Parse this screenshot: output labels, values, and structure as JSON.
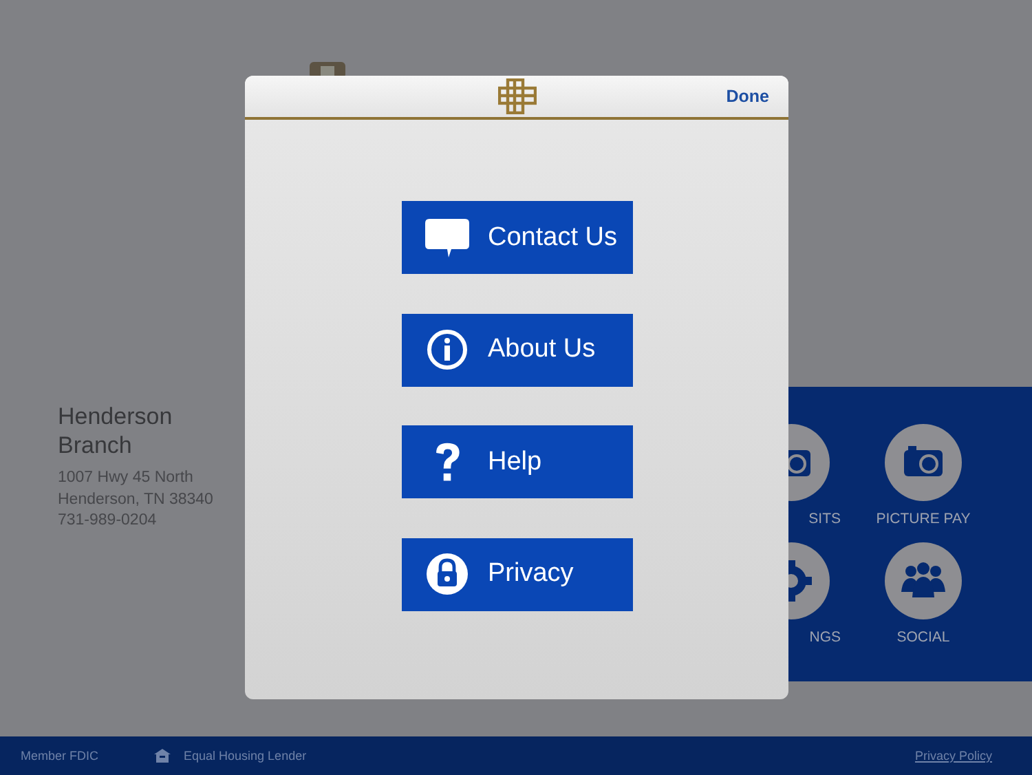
{
  "branch": {
    "name": "Henderson Branch",
    "address_lines": [
      "1007 Hwy 45 North",
      "Henderson, TN 38340",
      "731-989-0204"
    ]
  },
  "tiles": [
    {
      "label": "SITS",
      "kind": "deposit"
    },
    {
      "label": "PICTURE PAY",
      "kind": "camera"
    },
    {
      "label": "NGS",
      "kind": "gear"
    },
    {
      "label": "SOCIAL",
      "kind": "people"
    }
  ],
  "dialog": {
    "done": "Done",
    "buttons": [
      {
        "label": "Contact Us",
        "kind": "chat"
      },
      {
        "label": "About Us",
        "kind": "info"
      },
      {
        "label": "Help",
        "kind": "help"
      },
      {
        "label": "Privacy",
        "kind": "lock"
      }
    ]
  },
  "footer": {
    "fdic": "Member FDIC",
    "housing": "Equal Housing Lender",
    "privacy": "Privacy Policy"
  }
}
